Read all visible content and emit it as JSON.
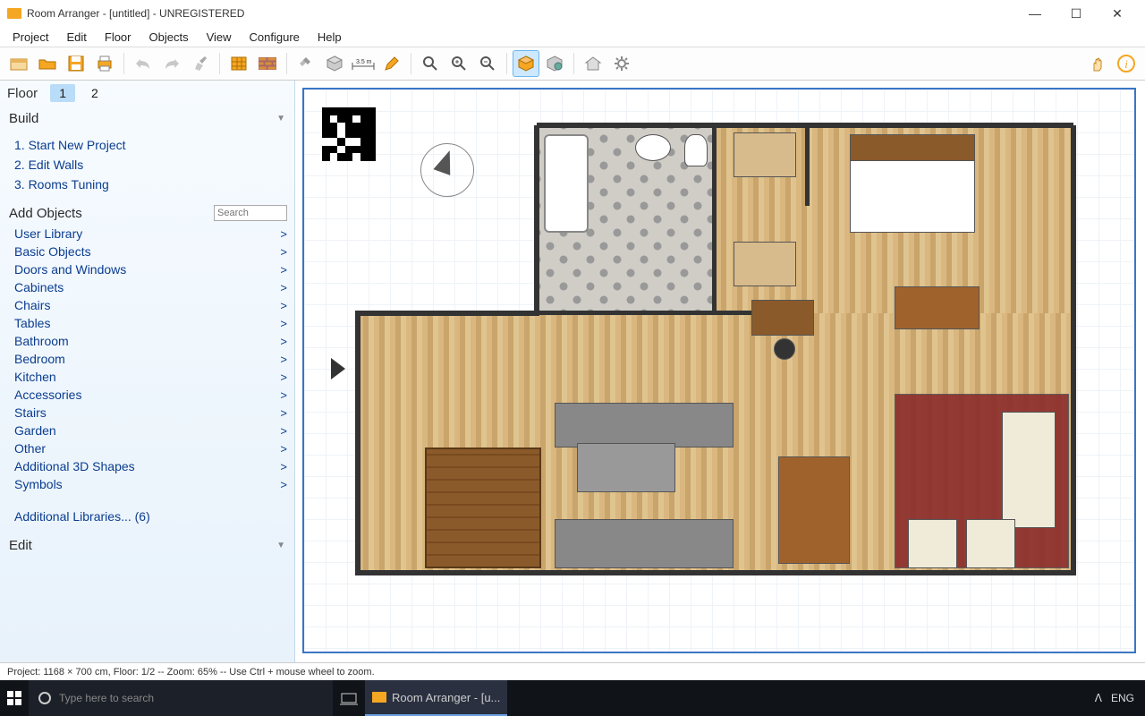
{
  "window": {
    "title": "Room Arranger - [untitled] - UNREGISTERED",
    "controls": {
      "min": "—",
      "max": "☐",
      "close": "✕"
    }
  },
  "menu": [
    "Project",
    "Edit",
    "Floor",
    "Objects",
    "View",
    "Configure",
    "Help"
  ],
  "sidebar": {
    "floor_label": "Floor",
    "floors": [
      "1",
      "2"
    ],
    "active_floor": 0,
    "build_label": "Build",
    "build_items": [
      "1. Start New Project",
      "2. Edit Walls",
      "3. Rooms Tuning"
    ],
    "addobj_label": "Add Objects",
    "search_placeholder": "Search",
    "categories": [
      "User Library",
      "Basic Objects",
      "Doors and Windows",
      "Cabinets",
      "Chairs",
      "Tables",
      "Bathroom",
      "Bedroom",
      "Kitchen",
      "Accessories",
      "Stairs",
      "Garden",
      "Other",
      "Additional 3D Shapes",
      "Symbols"
    ],
    "additional_label": "Additional Libraries... (6)",
    "edit_label": "Edit"
  },
  "statusbar": {
    "text": "Project: 1168 × 700 cm, Floor: 1/2 -- Zoom: 65% -- Use Ctrl + mouse wheel to zoom."
  },
  "taskbar": {
    "search_placeholder": "Type here to search",
    "app_label": "Room Arranger - [u...",
    "lang": "ENG"
  },
  "toolbar_icons": [
    "new-project",
    "open",
    "save",
    "print",
    "undo",
    "redo",
    "brush",
    "grid",
    "walls",
    "snap",
    "object",
    "measure",
    "pencil",
    "zoom",
    "zoom-in",
    "zoom-out",
    "3d-view-active",
    "3d-pan",
    "home-3d",
    "settings"
  ]
}
